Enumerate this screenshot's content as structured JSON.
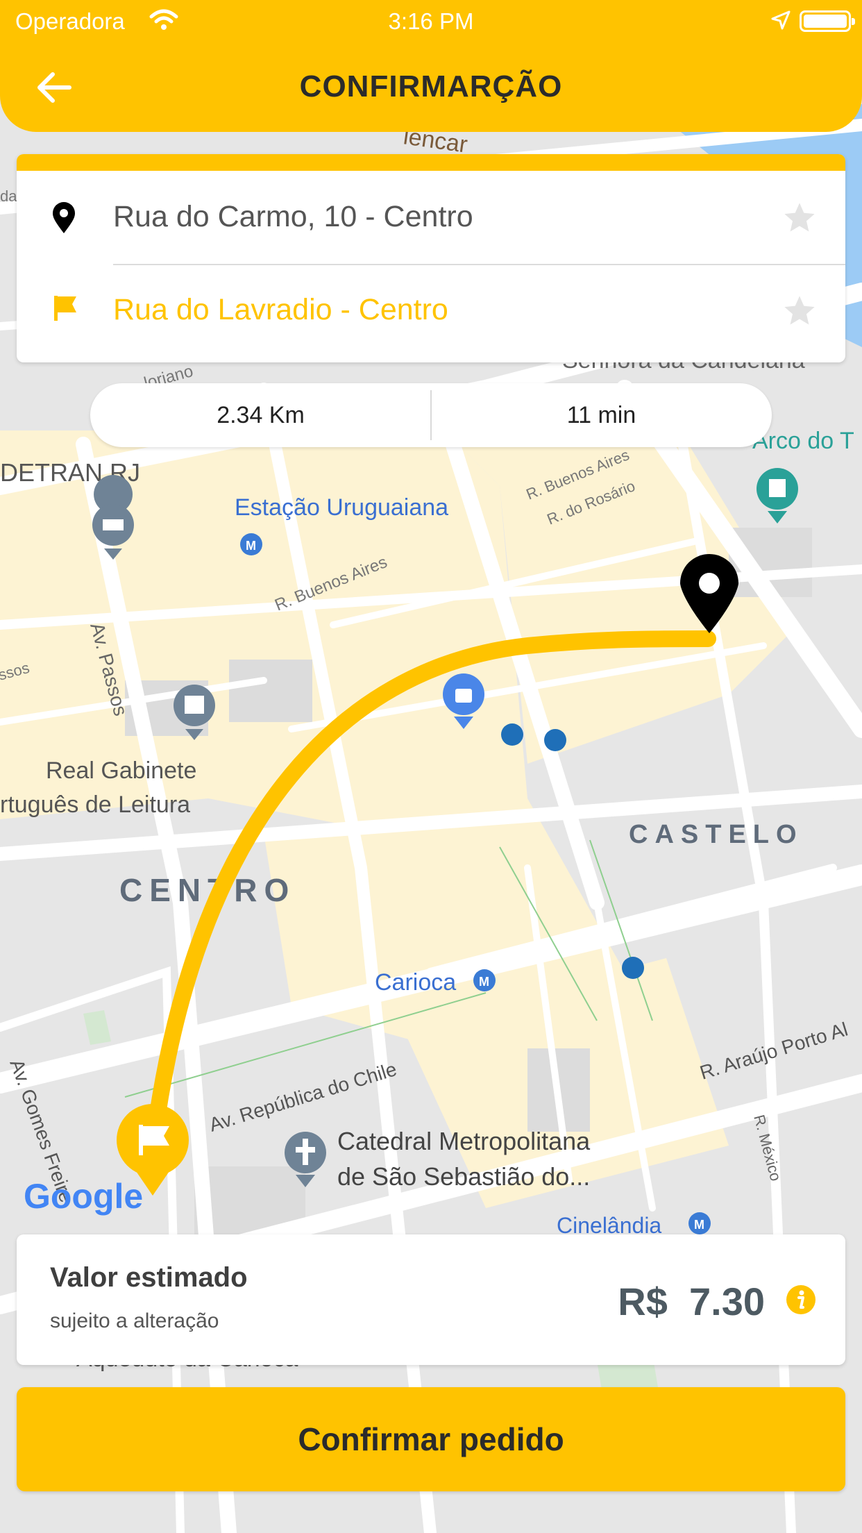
{
  "status_bar": {
    "carrier": "Operadora",
    "time": "3:16 PM"
  },
  "header": {
    "title": "CONFIRMARÇÃO",
    "back_icon": "arrow-left-icon"
  },
  "route": {
    "origin": "Rua do Carmo, 10 - Centro",
    "destination": "Rua do Lavradio - Centro",
    "distance": "2.34 Km",
    "duration": "11 min"
  },
  "price": {
    "label": "Valor estimado",
    "sublabel": "sujeito a alteração",
    "value": "R$  7.30"
  },
  "confirm_label": "Confirmar pedido",
  "map": {
    "labels": {
      "detran": "DETRAN.RJ",
      "uruguaiana": "Estação Uruguaiana",
      "buenos_aires": "R. Buenos Aires",
      "buenos_aires_2": "R. Buenos Aires",
      "rosario": "R. do Rosário",
      "passos": "Av. Passos",
      "gabinete_1": "Real Gabinete",
      "gabinete_2": "rtuguês de Leitura",
      "centro": "CENTRO",
      "castelo": "CASTELO",
      "carioca": "Carioca",
      "chile": "Av. República do Chile",
      "araujo": "R. Araújo Porto Al",
      "catedral_1": "Catedral Metropolitana",
      "catedral_2": "de São Sebastião do...",
      "gomes": "Av. Gomes Freire",
      "mexico": "R. México",
      "cinelandia": "Cinelândia",
      "arco": "Arco do T",
      "candelaria": "Senhora da Candelária",
      "alencar": "lencar",
      "aqueduto": "Aqueduto da Carioca",
      "floriano": "loriano",
      "ssos": "ssos",
      "dda": "da",
      "google": "Google"
    }
  },
  "colors": {
    "brand": "#FFC300",
    "route": "#FFC300",
    "price": "#4d5a62",
    "map_block": "#FDF3D3",
    "map_road": "#ffffff",
    "map_bg": "#e8e8e8",
    "water": "#9ccbf5"
  }
}
